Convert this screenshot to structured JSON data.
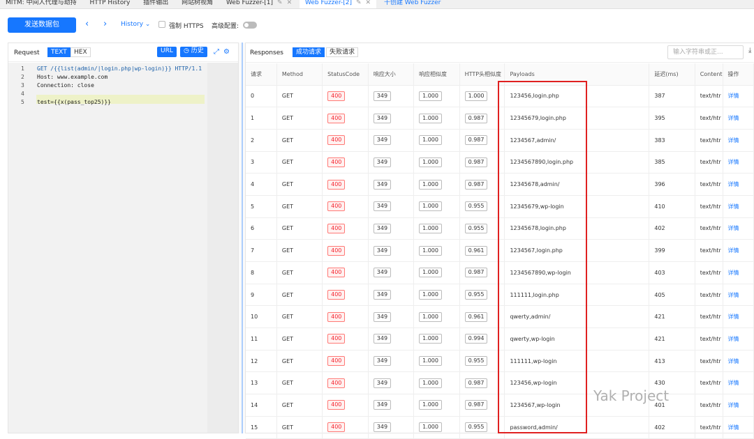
{
  "tabs": [
    {
      "label": "MITM: 中间人代理与劫持"
    },
    {
      "label": "HTTP History"
    },
    {
      "label": "插件输出"
    },
    {
      "label": "网站树视角"
    },
    {
      "label": "Web Fuzzer-[1]"
    },
    {
      "label": "Web Fuzzer-[2]"
    },
    {
      "label": "十创建 Web Fuzzer"
    }
  ],
  "toolbar": {
    "send_label": "发送数据包",
    "history_label": "History",
    "force_https_label": "强制 HTTPS",
    "advanced_label": "高级配置:"
  },
  "request": {
    "title": "Request",
    "text_tab": "TEXT",
    "hex_tab": "HEX",
    "url_btn": "URL",
    "history_btn": "历史",
    "lines": [
      {
        "num": "1",
        "text": "GET /{{list(admin/|login.php|wp-login)}} HTTP/1.1"
      },
      {
        "num": "2",
        "text": "Host: www.example.com"
      },
      {
        "num": "3",
        "text": "Connection: close"
      },
      {
        "num": "4",
        "text": ""
      },
      {
        "num": "5",
        "text": "test={{x(pass_top25)}}"
      }
    ]
  },
  "responses": {
    "title": "Responses",
    "success_tab": "成功请求",
    "fail_tab": "失败请求",
    "filter_placeholder": "输入字符串或正...",
    "columns": [
      "请求",
      "Method",
      "StatusCode",
      "响应大小",
      "响应相似度",
      "HTTP头相似度",
      "Payloads",
      "延迟(ms)",
      "Content",
      "操作"
    ],
    "detail_label": "详情",
    "rows": [
      {
        "id": "0",
        "method": "GET",
        "status": "400",
        "size": "349",
        "sim": "1.000",
        "hsim": "1.000",
        "payload": "123456,login.php",
        "delay": "387",
        "ctype": "text/htr"
      },
      {
        "id": "1",
        "method": "GET",
        "status": "400",
        "size": "349",
        "sim": "1.000",
        "hsim": "0.987",
        "payload": "12345679,login.php",
        "delay": "395",
        "ctype": "text/htr"
      },
      {
        "id": "2",
        "method": "GET",
        "status": "400",
        "size": "349",
        "sim": "1.000",
        "hsim": "0.987",
        "payload": "1234567,admin/",
        "delay": "383",
        "ctype": "text/htr"
      },
      {
        "id": "3",
        "method": "GET",
        "status": "400",
        "size": "349",
        "sim": "1.000",
        "hsim": "0.987",
        "payload": "1234567890,login.php",
        "delay": "385",
        "ctype": "text/htr"
      },
      {
        "id": "4",
        "method": "GET",
        "status": "400",
        "size": "349",
        "sim": "1.000",
        "hsim": "0.987",
        "payload": "12345678,admin/",
        "delay": "396",
        "ctype": "text/htr"
      },
      {
        "id": "5",
        "method": "GET",
        "status": "400",
        "size": "349",
        "sim": "1.000",
        "hsim": "0.955",
        "payload": "12345679,wp-login",
        "delay": "410",
        "ctype": "text/htr"
      },
      {
        "id": "6",
        "method": "GET",
        "status": "400",
        "size": "349",
        "sim": "1.000",
        "hsim": "0.955",
        "payload": "12345678,login.php",
        "delay": "402",
        "ctype": "text/htr"
      },
      {
        "id": "7",
        "method": "GET",
        "status": "400",
        "size": "349",
        "sim": "1.000",
        "hsim": "0.961",
        "payload": "1234567,login.php",
        "delay": "399",
        "ctype": "text/htr"
      },
      {
        "id": "8",
        "method": "GET",
        "status": "400",
        "size": "349",
        "sim": "1.000",
        "hsim": "0.987",
        "payload": "1234567890,wp-login",
        "delay": "403",
        "ctype": "text/htr"
      },
      {
        "id": "9",
        "method": "GET",
        "status": "400",
        "size": "349",
        "sim": "1.000",
        "hsim": "0.955",
        "payload": "111111,login.php",
        "delay": "405",
        "ctype": "text/htr"
      },
      {
        "id": "10",
        "method": "GET",
        "status": "400",
        "size": "349",
        "sim": "1.000",
        "hsim": "0.961",
        "payload": "qwerty,admin/",
        "delay": "421",
        "ctype": "text/htr"
      },
      {
        "id": "11",
        "method": "GET",
        "status": "400",
        "size": "349",
        "sim": "1.000",
        "hsim": "0.994",
        "payload": "qwerty,wp-login",
        "delay": "421",
        "ctype": "text/htr"
      },
      {
        "id": "12",
        "method": "GET",
        "status": "400",
        "size": "349",
        "sim": "1.000",
        "hsim": "0.955",
        "payload": "111111,wp-login",
        "delay": "413",
        "ctype": "text/htr"
      },
      {
        "id": "13",
        "method": "GET",
        "status": "400",
        "size": "349",
        "sim": "1.000",
        "hsim": "0.987",
        "payload": "123456,wp-login",
        "delay": "430",
        "ctype": "text/htr"
      },
      {
        "id": "14",
        "method": "GET",
        "status": "400",
        "size": "349",
        "sim": "1.000",
        "hsim": "0.987",
        "payload": "1234567,wp-login",
        "delay": "401",
        "ctype": "text/htr"
      },
      {
        "id": "15",
        "method": "GET",
        "status": "400",
        "size": "349",
        "sim": "1.000",
        "hsim": "0.955",
        "payload": "password,admin/",
        "delay": "402",
        "ctype": "text/htr"
      }
    ]
  },
  "watermark": "Yak Project",
  "colors": {
    "accent": "#1677ff",
    "error": "#f5222d",
    "highlight_box": "#e02020"
  }
}
